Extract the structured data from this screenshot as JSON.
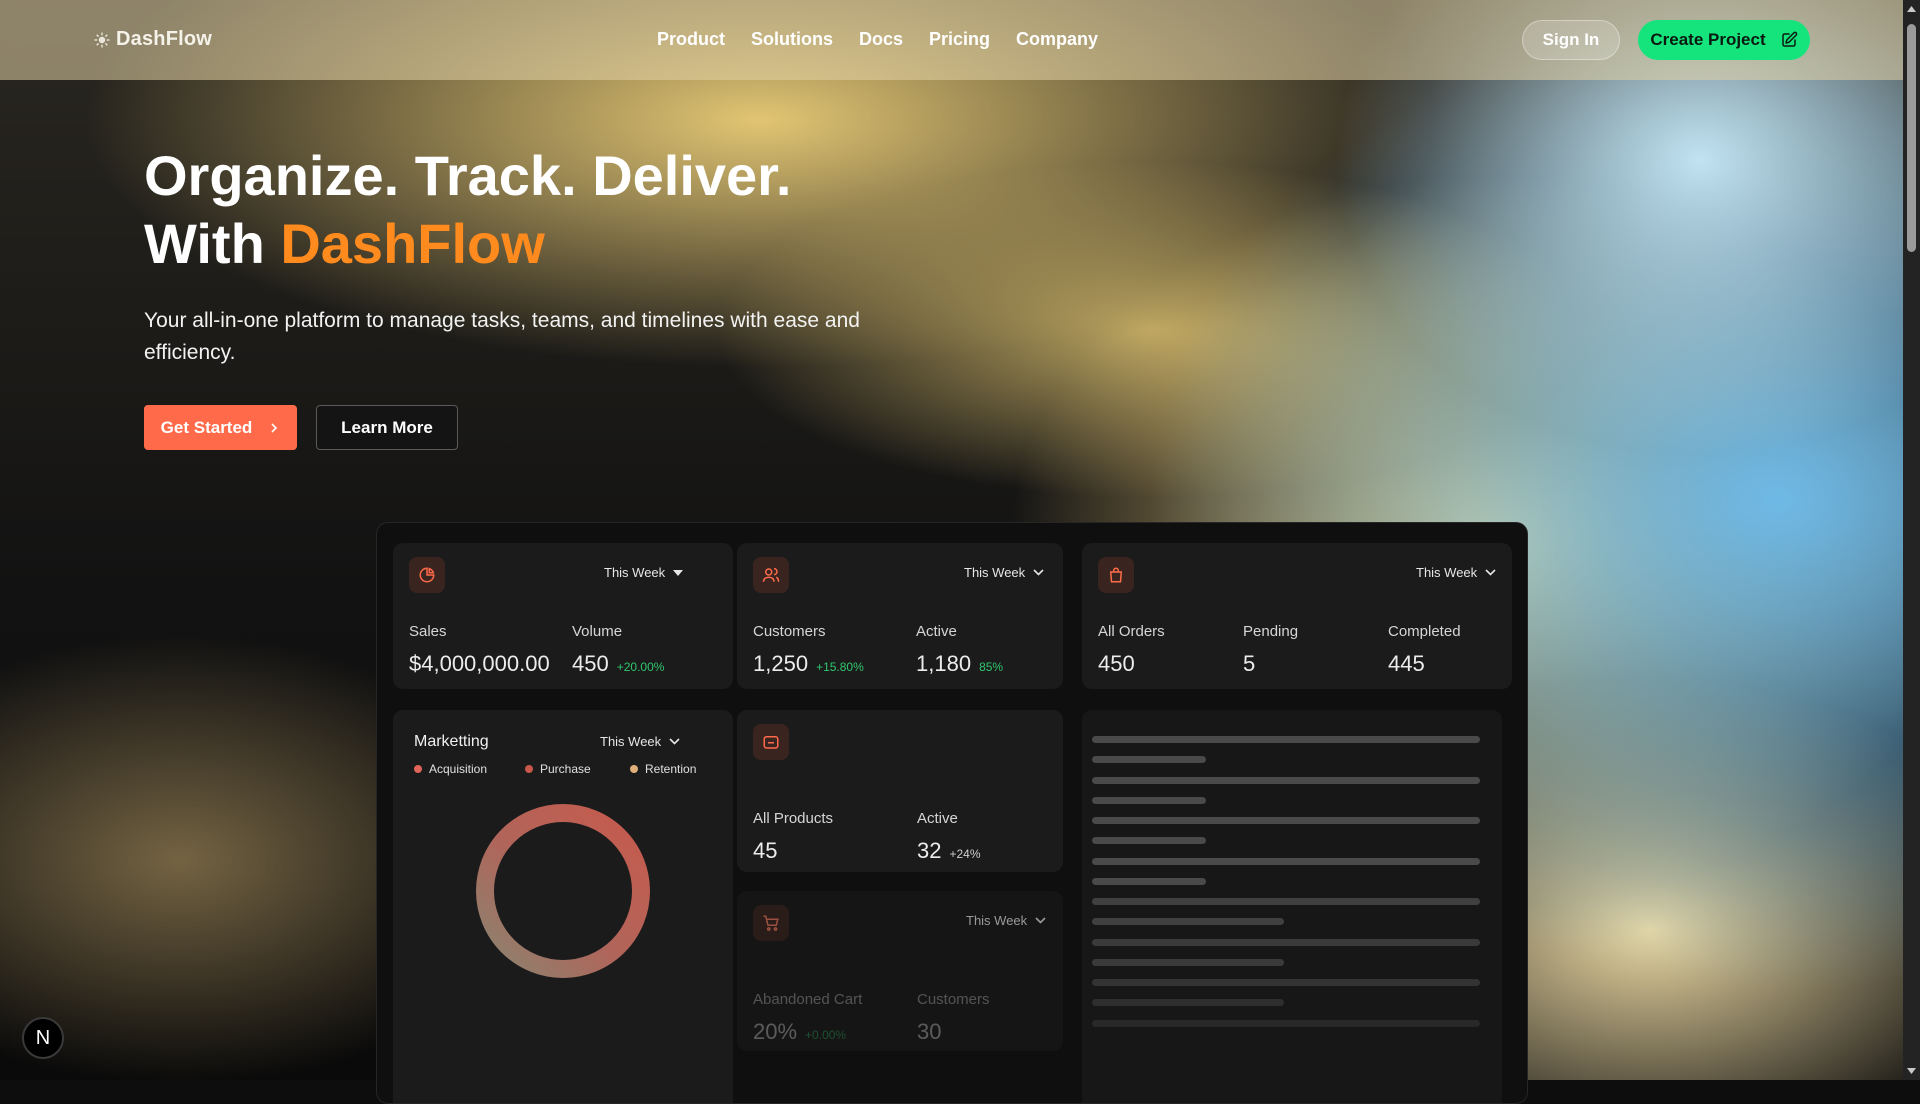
{
  "nav": {
    "brand": "DashFlow",
    "links": [
      "Product",
      "Solutions",
      "Docs",
      "Pricing",
      "Company"
    ],
    "sign_in": "Sign In",
    "create_project": "Create Project"
  },
  "hero": {
    "headline_line1": "Organize. Track. Deliver.",
    "headline_with": "With",
    "headline_brand": "DashFlow",
    "subtitle": "Your all-in-one platform to manage tasks, teams, and timelines with ease and efficiency.",
    "get_started": "Get Started",
    "learn_more": "Learn More"
  },
  "dashboard": {
    "period": "This Week",
    "sales": {
      "sales_label": "Sales",
      "sales_value": "$4,000,000.00",
      "volume_label": "Volume",
      "volume_value": "450",
      "volume_change": "+20.00%"
    },
    "customers": {
      "customers_label": "Customers",
      "customers_value": "1,250",
      "customers_change": "+15.80%",
      "active_label": "Active",
      "active_value": "1,180",
      "active_change": "85%"
    },
    "orders": {
      "all_orders_label": "All Orders",
      "all_orders_value": "450",
      "pending_label": "Pending",
      "pending_value": "5",
      "completed_label": "Completed",
      "completed_value": "445"
    },
    "marketing": {
      "title": "Marketting",
      "legend": [
        "Acquisition",
        "Purchase",
        "Retention"
      ]
    },
    "products": {
      "all_label": "All Products",
      "all_value": "45",
      "active_label": "Active",
      "active_value": "32",
      "active_change": "+24%"
    },
    "cart": {
      "abandoned_label": "Abandoned Cart",
      "abandoned_value": "20%",
      "abandoned_change": "+0.00%",
      "customers_label": "Customers",
      "customers_value": "30"
    }
  },
  "overlay": {
    "badge": "N"
  },
  "colors": {
    "accent_orange": "#ff8a1e",
    "cta_coral": "#ff6b4a",
    "create_green": "#15e47d",
    "positive_green": "#2fc76d",
    "legend_acquisition": "#e0645a",
    "legend_purchase": "#c9584b",
    "legend_retention": "#e1b07a"
  },
  "icons": [
    "sun-logo-icon",
    "edit-icon",
    "chevron-right-icon",
    "pie-chart-icon",
    "users-icon",
    "shopping-bag-icon",
    "folder-icon",
    "cart-icon",
    "chevron-down-icon"
  ]
}
